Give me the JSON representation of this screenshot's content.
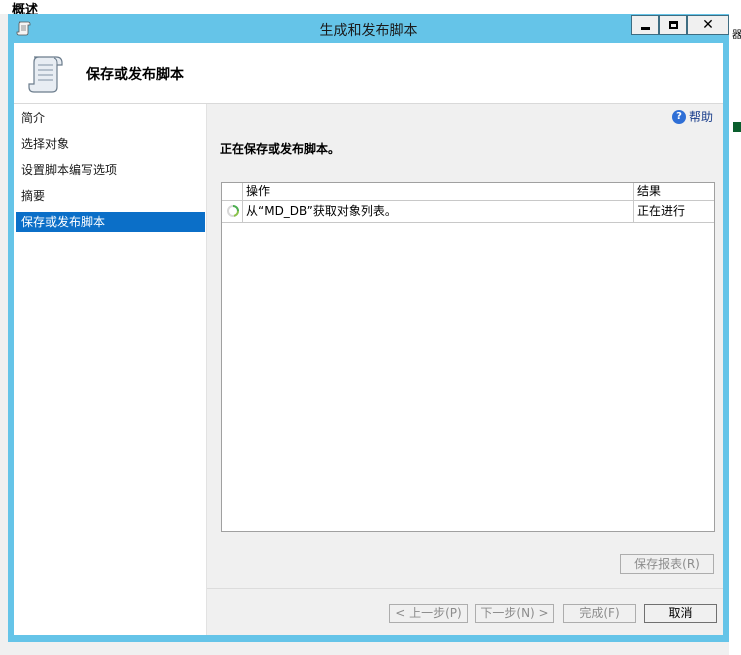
{
  "background": {
    "window_title": "概述",
    "frag_right": "器"
  },
  "dialog": {
    "title": "生成和发布脚本",
    "header_title": "保存或发布脚本",
    "nav": {
      "items": [
        {
          "label": "简介"
        },
        {
          "label": "选择对象"
        },
        {
          "label": "设置脚本编写选项"
        },
        {
          "label": "摘要"
        },
        {
          "label": "保存或发布脚本",
          "active": true
        }
      ]
    },
    "help_label": "帮助",
    "status_heading": "正在保存或发布脚本。",
    "grid": {
      "columns": [
        "操作",
        "结果"
      ],
      "rows": [
        {
          "operation": "从“MD_DB”获取对象列表。",
          "result": "正在进行",
          "icon": "spinner-icon"
        }
      ]
    },
    "save_report_label": "保存报表(R)",
    "footer": {
      "prev_label": "< 上一步(P)",
      "next_label": "下一步(N) >",
      "finish_label": "完成(F)",
      "cancel_label": "取消"
    },
    "colors": {
      "titlebar": "#65c4e8",
      "nav_active": "#0b6fc8"
    }
  }
}
